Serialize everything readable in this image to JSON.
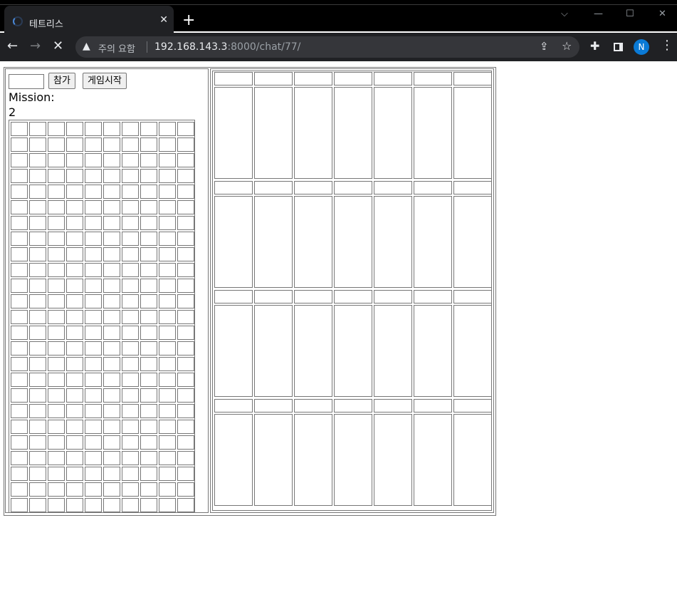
{
  "browser": {
    "tab_title": "테트리스",
    "tab_close": "✕",
    "new_tab": "+",
    "security_warning": "주의 요함",
    "url_host": "192.168.143.3",
    "url_rest": ":8000/chat/77/",
    "avatar_letter": "N"
  },
  "game": {
    "join_input_value": "",
    "join_button": "참가",
    "start_button": "게임시작",
    "mission_label": "Mission:",
    "mission_value": "2",
    "board_columns": 10,
    "board_rows": 25,
    "opponent_panels": 4,
    "opponent_columns": 7
  },
  "colors": {
    "chrome_bg": "#202124",
    "tab_strip": "#000000",
    "omnibox": "#35363a",
    "avatar": "#0a7ad6",
    "cell_border": "#777777"
  }
}
